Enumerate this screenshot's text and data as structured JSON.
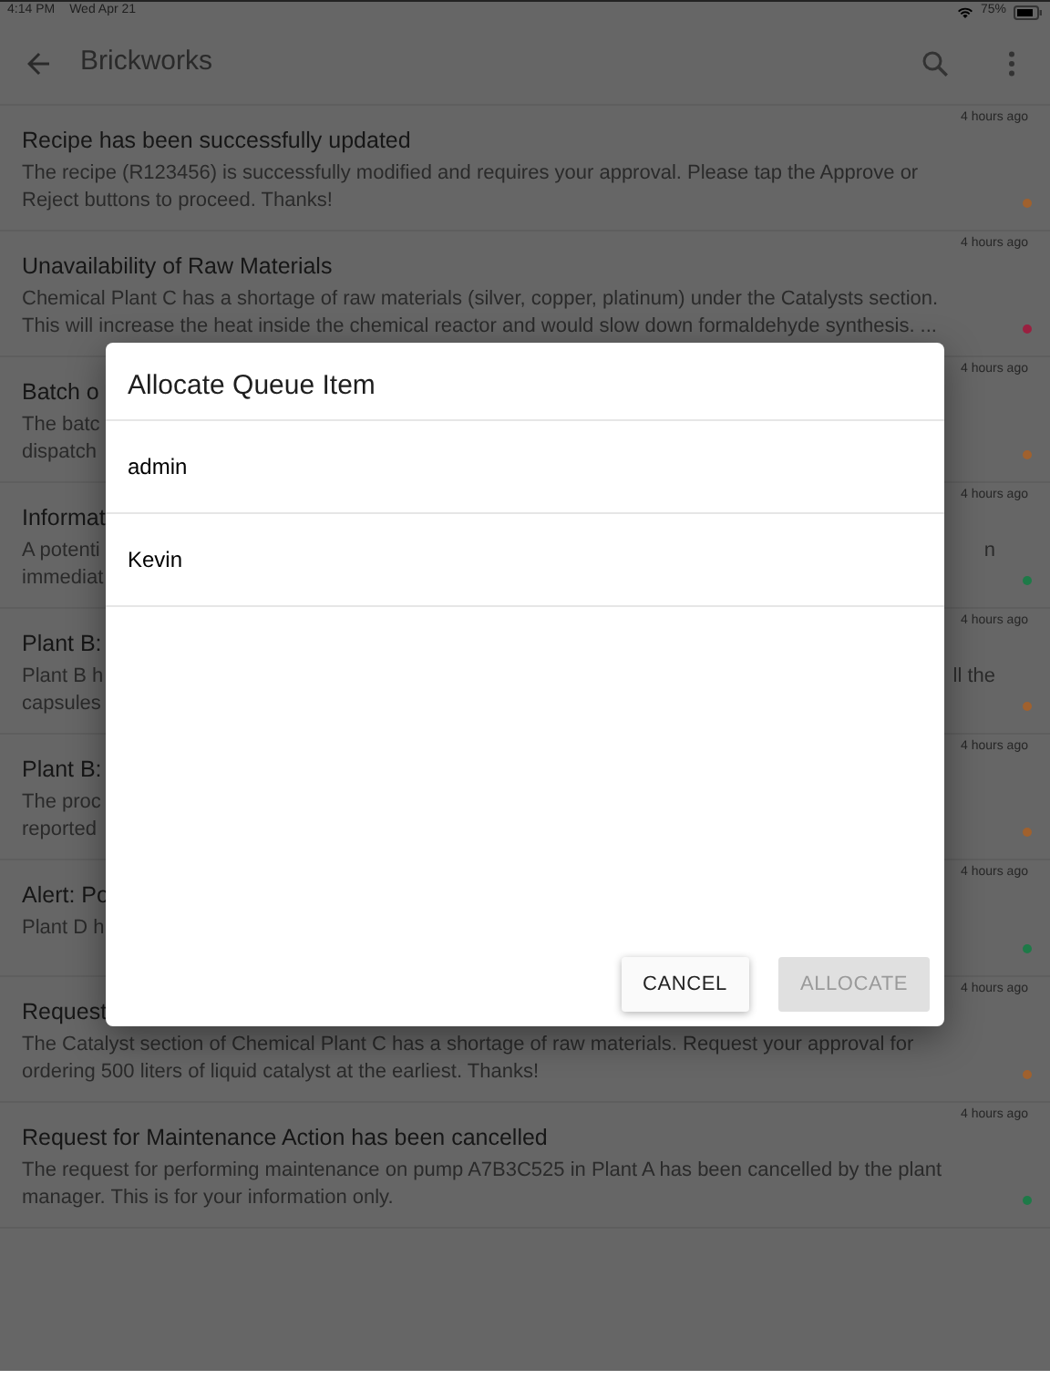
{
  "status_bar": {
    "time": "4:14 PM",
    "date": "Wed Apr 21",
    "battery": "75%"
  },
  "app_bar": {
    "title": "Brickworks"
  },
  "notifications": [
    {
      "kind": "full",
      "time": "4 hours ago",
      "title": "Recipe has been successfully updated",
      "body": "The recipe (R123456) is successfully modified and requires your approval. Please tap the Approve or Reject buttons to proceed. Thanks!",
      "color": "#a0612e"
    },
    {
      "kind": "full",
      "time": "4 hours ago",
      "title": "Unavailability of Raw Materials",
      "body": "Chemical Plant C has a shortage of raw materials (silver, copper, platinum) under the Catalysts section. This will increase the heat inside the chemical reactor and would slow down formaldehyde synthesis. ...",
      "color": "#9a2040"
    },
    {
      "kind": "covered",
      "time": "4 hours ago",
      "title": "Batch o",
      "lines": [
        {
          "left": "The batc"
        },
        {
          "left": "dispatch"
        }
      ],
      "color": "#a0612e"
    },
    {
      "kind": "covered",
      "time": "4 hours ago",
      "title": "Informat",
      "lines": [
        {
          "left": "A potenti",
          "right": "n"
        },
        {
          "left": "immediat"
        }
      ],
      "color": "#1e7a48"
    },
    {
      "kind": "covered",
      "time": "4 hours ago",
      "title": "Plant B:",
      "lines": [
        {
          "left": "Plant B h",
          "right": "ll the"
        },
        {
          "left": "capsules"
        }
      ],
      "color": "#a0612e"
    },
    {
      "kind": "covered",
      "time": "4 hours ago",
      "title": "Plant B:",
      "lines": [
        {
          "left": "The proc"
        },
        {
          "left": "reported"
        }
      ],
      "color": "#a0612e"
    },
    {
      "kind": "covered",
      "time": "4 hours ago",
      "title": "Alert: Po",
      "lines": [
        {
          "left": "Plant D h"
        }
      ],
      "color": "#1e7a48"
    },
    {
      "kind": "full",
      "time": "4 hours ago",
      "title": "Request",
      "body": "The Catalyst section of Chemical Plant C has a shortage of raw materials. Request your approval for ordering 500 liters of liquid catalyst at the earliest. Thanks!",
      "color": "#a0612e"
    },
    {
      "kind": "full",
      "time": "4 hours ago",
      "title": "Request for Maintenance Action has been cancelled",
      "body": "The request for performing maintenance on pump A7B3C525 in Plant A has been cancelled by the plant manager. This is for your information only.",
      "color": "#1e7a48"
    }
  ],
  "dialog": {
    "title": "Allocate Queue Item",
    "options": [
      "admin",
      "Kevin"
    ],
    "buttons": [
      {
        "label": "CANCEL",
        "disabled": false
      },
      {
        "label": "ALLOCATE",
        "disabled": true
      }
    ]
  }
}
